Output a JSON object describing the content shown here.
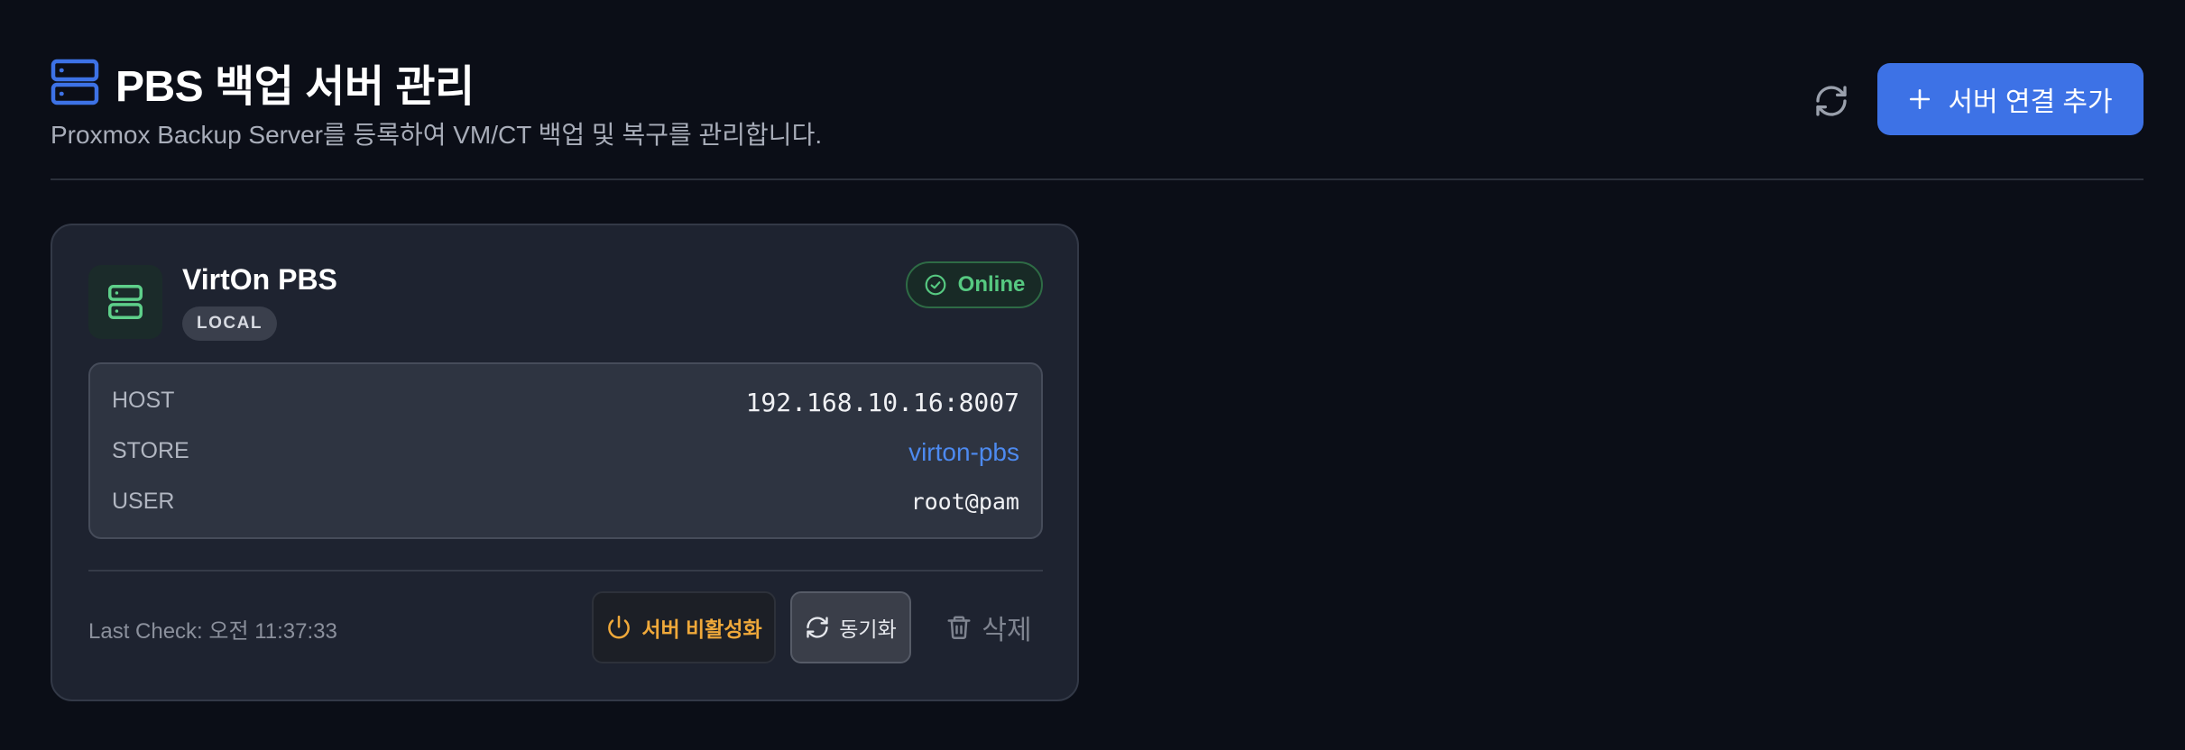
{
  "header": {
    "title": "PBS 백업 서버 관리",
    "subtitle": "Proxmox Backup Server를 등록하여 VM/CT 백업 및 복구를 관리합니다.",
    "add_button_label": "서버 연결 추가",
    "icons": {
      "title": "server-stack-icon",
      "refresh": "refresh-icon",
      "add": "plus-icon"
    }
  },
  "servers": [
    {
      "name": "VirtOn PBS",
      "badge": "LOCAL",
      "status": "Online",
      "fields": [
        {
          "label": "HOST",
          "value": "192.168.10.16:8007"
        },
        {
          "label": "STORE",
          "value": "virton-pbs"
        },
        {
          "label": "USER",
          "value": "root@pam"
        }
      ],
      "last_check": "Last Check: 오전 11:37:33",
      "actions": {
        "disable_label": "서버 비활성화",
        "sync_label": "동기화",
        "delete_label": "삭제"
      }
    }
  ],
  "colors": {
    "background": "#0b0e17",
    "card": "#1e2330",
    "accent": "#3d72e6",
    "online": "#56c981",
    "warning": "#f0a93a",
    "link": "#4d8af0",
    "server_icon": "#5ed08a"
  }
}
